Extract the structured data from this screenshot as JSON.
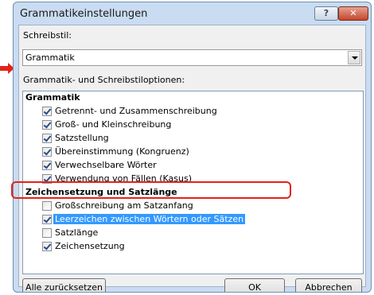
{
  "window": {
    "title": "Grammatikeinstellungen",
    "help_label": "?",
    "close_label": "✕"
  },
  "labels": {
    "writing_style": "Schreibstil:",
    "options": "Grammatik- und Schreibstiloptionen:"
  },
  "writing_style_select": {
    "value": "Grammatik"
  },
  "categories": [
    {
      "name": "Grammatik",
      "options": [
        {
          "label": "Getrennt- und Zusammenschreibung",
          "checked": true
        },
        {
          "label": "Groß- und Kleinschreibung",
          "checked": true
        },
        {
          "label": "Satzstellung",
          "checked": true
        },
        {
          "label": "Übereinstimmung (Kongruenz)",
          "checked": true
        },
        {
          "label": "Verwechselbare Wörter",
          "checked": true
        },
        {
          "label": "Verwendung von Fällen (Kasus)",
          "checked": true
        }
      ]
    },
    {
      "name": "Zeichensetzung und Satzlänge",
      "options": [
        {
          "label": "Großschreibung am Satzanfang",
          "checked": false
        },
        {
          "label": "Leerzeichen zwischen Wörtern oder Sätzen",
          "checked": true,
          "selected": true
        },
        {
          "label": "Satzlänge",
          "checked": false
        },
        {
          "label": "Zeichensetzung",
          "checked": true
        }
      ]
    }
  ],
  "buttons": {
    "reset": "Alle zurücksetzen",
    "ok": "OK",
    "cancel": "Abbrechen"
  },
  "colors": {
    "selection": "#3399ff",
    "highlight_ring": "#e2231a",
    "arrow": "#e2231a"
  }
}
